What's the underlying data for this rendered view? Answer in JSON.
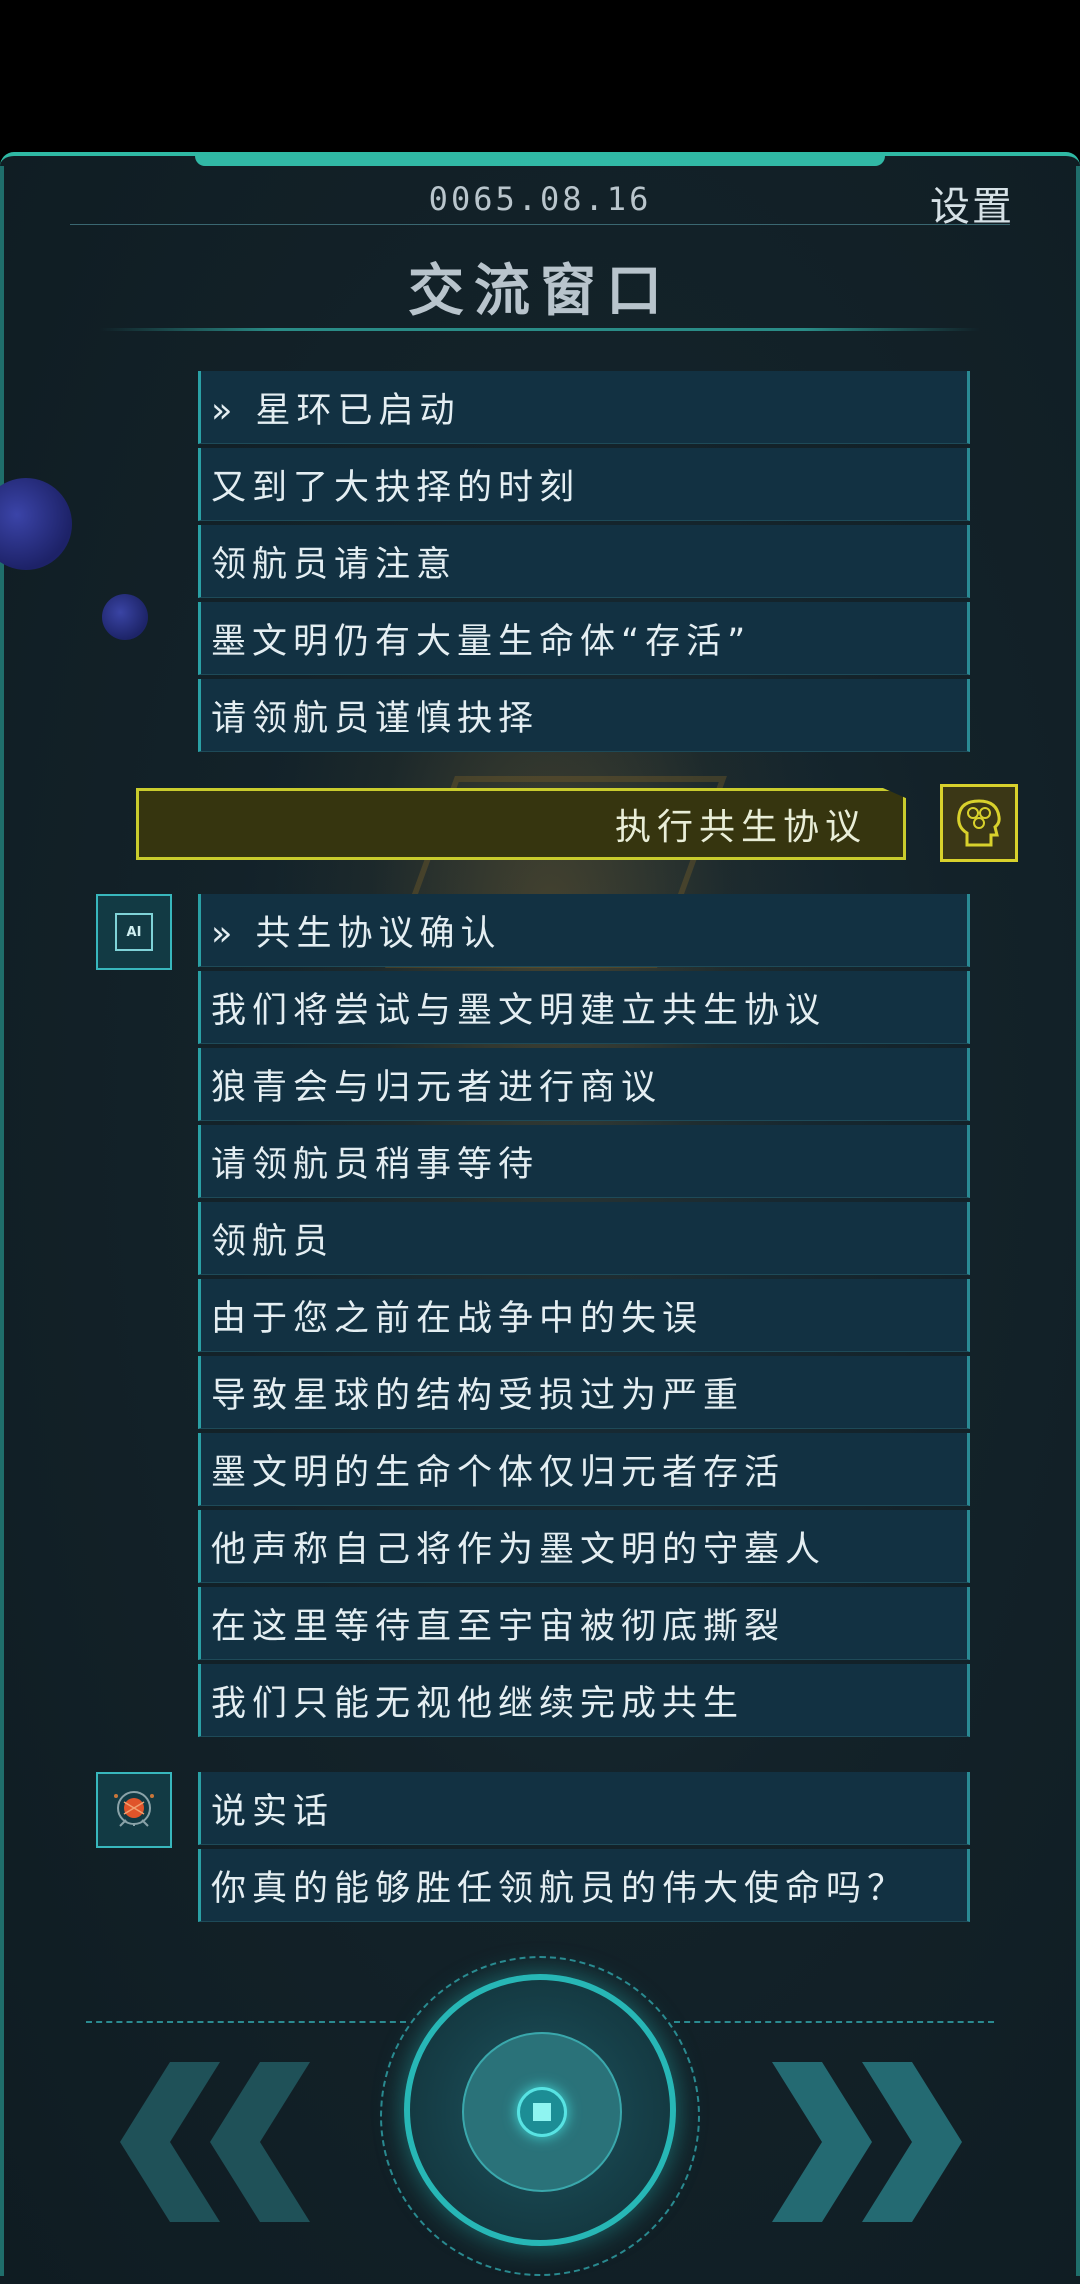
{
  "header": {
    "date": "0065.08.16",
    "settings_label": "设置",
    "title": "交流窗口"
  },
  "messages_group1": [
    "» 星环已启动",
    "又到了大抉择的时刻",
    "领航员请注意",
    "墨文明仍有大量生命体“存活”",
    "请领航员谨慎抉择"
  ],
  "player_reply": "执行共生协议",
  "ai_badge": "AI",
  "messages_group2": [
    "» 共生协议确认",
    "我们将尝试与墨文明建立共生协议",
    "狼青会与归元者进行商议",
    "请领航员稍事等待",
    "领航员",
    "由于您之前在战争中的失误",
    "导致星球的结构受损过为严重",
    "墨文明的生命个体仅归元者存活",
    "他声称自己将作为墨文明的守墓人",
    "在这里等待直至宇宙被彻底撕裂",
    "我们只能无视他继续完成共生"
  ],
  "messages_group3": [
    "说实话",
    "你真的能够胜任领航员的伟大使命吗？"
  ],
  "icons": {
    "player_avatar": "brain-head-icon",
    "ai_avatar": "ai-chip-icon",
    "bot_avatar": "robot-orb-icon",
    "prev": "double-chevron-left-icon",
    "next": "double-chevron-right-icon"
  },
  "colors": {
    "accent": "#2fb9a4",
    "reply_border": "#c9cc2d",
    "message_bg": "#123142"
  }
}
